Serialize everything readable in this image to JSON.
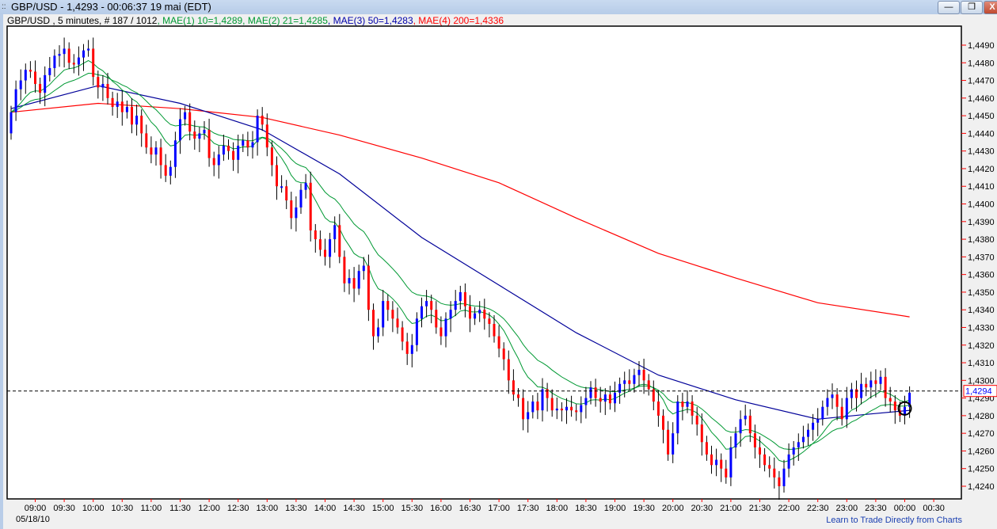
{
  "window": {
    "title": "GBP/USD - 1,4293 - 00:06:37  19 mai (EDT)",
    "grip_icon": "grip-icon",
    "minimize": "—",
    "restore": "❐",
    "close": "X"
  },
  "header": {
    "symbol": "GBP/USD , 5 minutes, # 187 / 1012",
    "mae1": ", MAE(1) 10=1,4289",
    "mae2": ", MAE(2) 21=1,4285",
    "mae3": ", MAE(3) 50=1,4283",
    "mae4": ", MAE(4) 200=1,4336"
  },
  "footer": {
    "date": "05/18/10",
    "link": "Learn to Trade Directly from Charts"
  },
  "colors": {
    "up": "#0000ff",
    "down": "#ff0000",
    "mae10": "#009933",
    "mae21": "#009933",
    "mae50": "#000099",
    "mae200": "#ff0000",
    "tick": "#ff0000"
  },
  "chart_data": {
    "type": "candlestick",
    "interval": "5 minutes",
    "first_bar_time": "08:35",
    "ylim": [
      1.4232,
      1.45
    ],
    "yticks": [
      1.449,
      1.448,
      1.447,
      1.446,
      1.445,
      1.444,
      1.443,
      1.442,
      1.441,
      1.44,
      1.439,
      1.438,
      1.437,
      1.436,
      1.435,
      1.434,
      1.433,
      1.432,
      1.431,
      1.43,
      1.429,
      1.428,
      1.427,
      1.426,
      1.425,
      1.424
    ],
    "ytick_labels": [
      "1,4490",
      "1,4480",
      "1,4470",
      "1,4460",
      "1,4450",
      "1,4440",
      "1,4430",
      "1,4420",
      "1,4410",
      "1,4400",
      "1,4390",
      "1,4380",
      "1,4370",
      "1,4360",
      "1,4350",
      "1,4340",
      "1,4330",
      "1,4320",
      "1,4310",
      "1,4300",
      "1,4290",
      "1,4280",
      "1,4270",
      "1,4260",
      "1,4250",
      "1,4240"
    ],
    "xtick_labels": [
      "09:00",
      "09:30",
      "10:00",
      "10:30",
      "11:00",
      "11:30",
      "12:00",
      "12:30",
      "13:00",
      "13:30",
      "14:00",
      "14:30",
      "15:00",
      "15:30",
      "16:00",
      "16:30",
      "17:00",
      "17:30",
      "18:00",
      "18:30",
      "19:00",
      "19:30",
      "20:00",
      "20:30",
      "21:00",
      "21:30",
      "22:00",
      "22:30",
      "23:00",
      "23:30",
      "00:00",
      "00:30"
    ],
    "first_open": 1.444,
    "close": [
      1.4452,
      1.4465,
      1.447,
      1.4476,
      1.4475,
      1.4468,
      1.4463,
      1.4473,
      1.4477,
      1.4484,
      1.4485,
      1.4488,
      1.448,
      1.4479,
      1.4483,
      1.4487,
      1.4488,
      1.4472,
      1.4466,
      1.4468,
      1.446,
      1.4455,
      1.4458,
      1.4452,
      1.4455,
      1.4445,
      1.445,
      1.444,
      1.4432,
      1.4428,
      1.4432,
      1.4422,
      1.4416,
      1.4421,
      1.4436,
      1.4448,
      1.4452,
      1.4441,
      1.4437,
      1.444,
      1.4442,
      1.4426,
      1.4422,
      1.4428,
      1.4433,
      1.443,
      1.4425,
      1.4433,
      1.4436,
      1.4432,
      1.4435,
      1.445,
      1.4445,
      1.4432,
      1.4422,
      1.441,
      1.441,
      1.4402,
      1.4392,
      1.4398,
      1.4408,
      1.4412,
      1.4385,
      1.438,
      1.4374,
      1.437,
      1.438,
      1.4388,
      1.437,
      1.4355,
      1.4358,
      1.4352,
      1.4362,
      1.4365,
      1.434,
      1.4325,
      1.433,
      1.4345,
      1.434,
      1.4335,
      1.433,
      1.4322,
      1.4315,
      1.432,
      1.4335,
      1.4342,
      1.4345,
      1.434,
      1.433,
      1.4325,
      1.4335,
      1.434,
      1.4345,
      1.435,
      1.4342,
      1.4335,
      1.4338,
      1.434,
      1.4335,
      1.4332,
      1.4325,
      1.4318,
      1.4312,
      1.43,
      1.4292,
      1.429,
      1.4278,
      1.4282,
      1.4288,
      1.4283,
      1.4295,
      1.429,
      1.4283,
      1.4284,
      1.4283,
      1.4285,
      1.4283,
      1.4282,
      1.4286,
      1.429,
      1.4296,
      1.429,
      1.4288,
      1.4292,
      1.4287,
      1.4293,
      1.4298,
      1.43,
      1.4298,
      1.4303,
      1.4306,
      1.43,
      1.4295,
      1.4288,
      1.428,
      1.4272,
      1.4258,
      1.427,
      1.4288,
      1.4285,
      1.4288,
      1.428,
      1.4275,
      1.4265,
      1.4258,
      1.4252,
      1.4255,
      1.425,
      1.4245,
      1.4262,
      1.427,
      1.4278,
      1.428,
      1.427,
      1.4262,
      1.4258,
      1.4252,
      1.425,
      1.4245,
      1.424,
      1.425,
      1.4258,
      1.4262,
      1.4265,
      1.4268,
      1.4272,
      1.4276,
      1.4278,
      1.4285,
      1.429,
      1.4292,
      1.4285,
      1.4278,
      1.429,
      1.4295,
      1.429,
      1.4298,
      1.4296,
      1.43,
      1.4298,
      1.4302,
      1.429,
      1.4288,
      1.4283,
      1.428,
      1.4285,
      1.4293
    ],
    "series": [
      {
        "name": "MAE(1) 10",
        "type": "ema",
        "period": 10
      },
      {
        "name": "MAE(2) 21",
        "type": "ema",
        "period": 21
      },
      {
        "name": "MAE(3) 50",
        "points": [
          {
            "t": "08:35",
            "v": 1.4454
          },
          {
            "t": "10:05",
            "v": 1.4467
          },
          {
            "t": "11:30",
            "v": 1.4457
          },
          {
            "t": "12:55",
            "v": 1.4442
          },
          {
            "t": "14:15",
            "v": 1.4417
          },
          {
            "t": "15:40",
            "v": 1.4381
          },
          {
            "t": "17:00",
            "v": 1.4354
          },
          {
            "t": "18:20",
            "v": 1.4327
          },
          {
            "t": "19:45",
            "v": 1.4303
          },
          {
            "t": "21:05",
            "v": 1.4289
          },
          {
            "t": "22:30",
            "v": 1.4278
          },
          {
            "t": "23:25",
            "v": 1.4281
          },
          {
            "t": "00:05",
            "v": 1.4283
          }
        ]
      },
      {
        "name": "MAE(4) 200",
        "points": [
          {
            "t": "08:35",
            "v": 1.4452
          },
          {
            "t": "10:05",
            "v": 1.4457
          },
          {
            "t": "11:30",
            "v": 1.4454
          },
          {
            "t": "12:55",
            "v": 1.4449
          },
          {
            "t": "14:15",
            "v": 1.4439
          },
          {
            "t": "15:40",
            "v": 1.4426
          },
          {
            "t": "17:00",
            "v": 1.4412
          },
          {
            "t": "18:20",
            "v": 1.4392
          },
          {
            "t": "19:45",
            "v": 1.4372
          },
          {
            "t": "21:05",
            "v": 1.4358
          },
          {
            "t": "22:30",
            "v": 1.4344
          },
          {
            "t": "00:05",
            "v": 1.4336
          }
        ]
      }
    ],
    "current_price": 1.4294,
    "current_price_label": "1,4294",
    "grid": false
  }
}
